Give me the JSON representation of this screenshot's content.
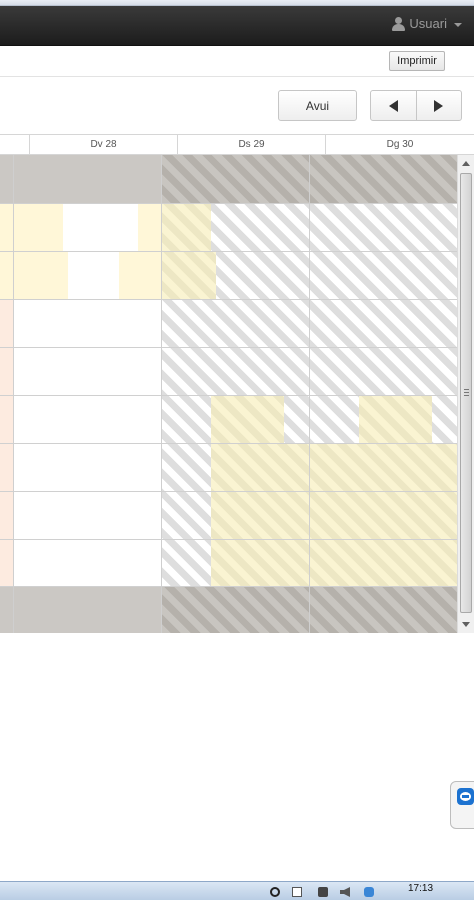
{
  "navbar": {
    "user_label": "Usuari"
  },
  "subbar": {
    "print_label": "Imprimir"
  },
  "toolbar": {
    "today_label": "Avui"
  },
  "calendar": {
    "days": [
      {
        "label": "Dv 28"
      },
      {
        "label": "Ds 29"
      },
      {
        "label": "Dg 30"
      }
    ]
  },
  "taskbar": {
    "clock": "17:13"
  },
  "colors": {
    "navbar": "#1c1c1c",
    "available": "#fff7d8",
    "unavailable_band": "#cbc8c4",
    "hatch": "#dedede"
  }
}
